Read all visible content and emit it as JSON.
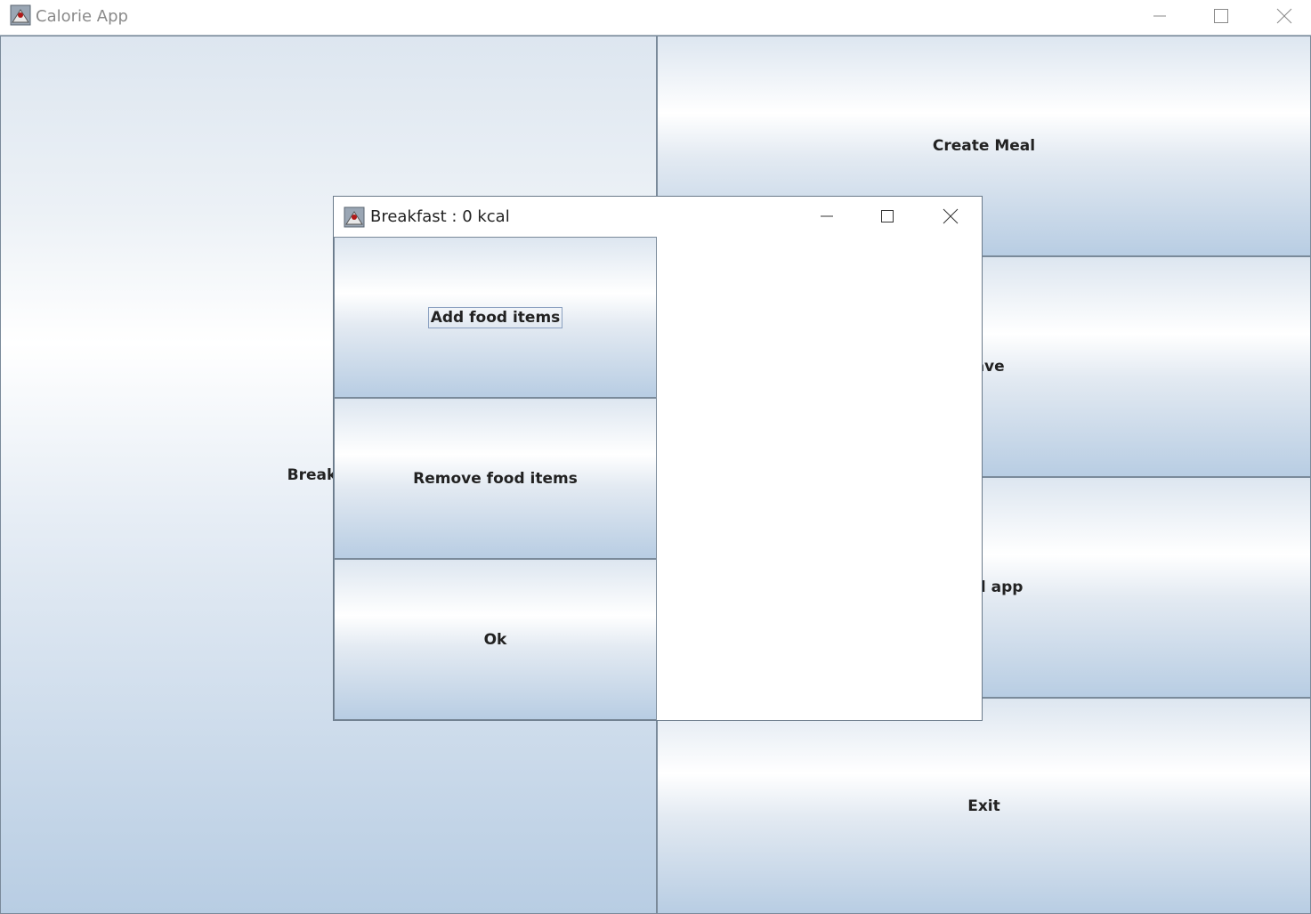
{
  "main_window": {
    "title": "Calorie App",
    "buttons": {
      "breakfast": "Breakfast",
      "create_meal": "Create Meal",
      "save": "Save",
      "load_app": "Load app",
      "exit": "Exit"
    }
  },
  "dialog": {
    "title": "Breakfast : 0 kcal",
    "buttons": {
      "add": "Add food items",
      "remove": "Remove food items",
      "ok": "Ok"
    }
  }
}
